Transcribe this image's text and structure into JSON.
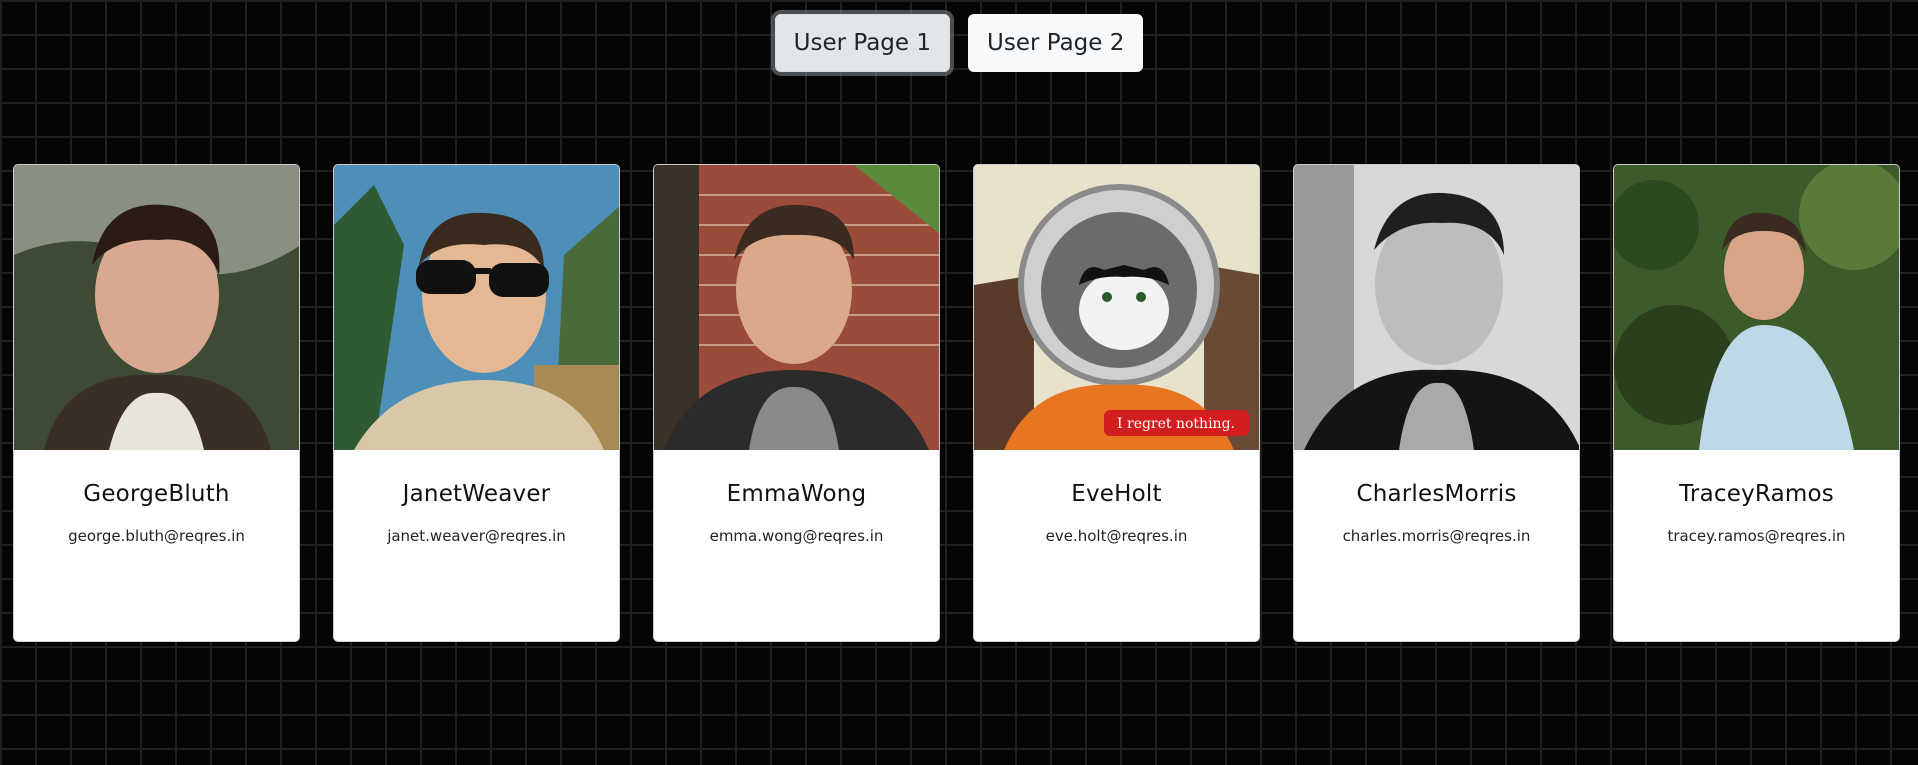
{
  "nav": {
    "buttons": [
      {
        "label": "User Page 1",
        "active": true
      },
      {
        "label": "User Page 2",
        "active": false
      }
    ]
  },
  "users": [
    {
      "name": "GeorgeBluth",
      "email": "george.bluth@reqres.in"
    },
    {
      "name": "JanetWeaver",
      "email": "janet.weaver@reqres.in"
    },
    {
      "name": "EmmaWong",
      "email": "emma.wong@reqres.in"
    },
    {
      "name": "EveHolt",
      "email": "eve.holt@reqres.in",
      "photo_caption": "I regret nothing."
    },
    {
      "name": "CharlesMorris",
      "email": "charles.morris@reqres.in"
    },
    {
      "name": "TraceyRamos",
      "email": "tracey.ramos@reqres.in"
    }
  ],
  "colors": {
    "page_background": "#050505",
    "card_background": "#ffffff",
    "button_background": "#f8f9fa",
    "active_button_background": "#e2e6ea"
  }
}
